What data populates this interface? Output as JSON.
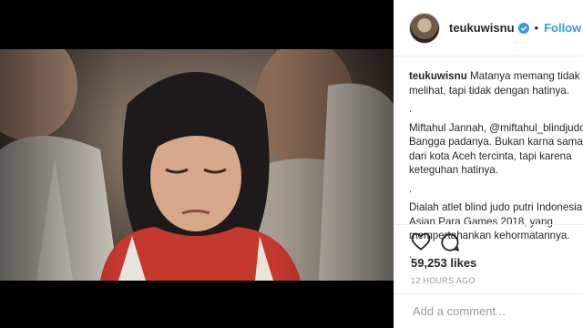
{
  "post": {
    "username": "teukuwisnu",
    "follow_label": "Follow",
    "separator": "•",
    "caption": {
      "username": "teukuwisnu",
      "lines": [
        "Matanya memang tidak",
        "melihat, tapi tidak dengan hatinya.",
        ".",
        "Miftahul Jannah, @miftahul_blindjudo",
        "Bangga padanya. Bukan karna sama-s",
        "dari kota Aceh tercinta, tapi karena",
        "keteguhan hatinya.",
        ".",
        "Dialah atlet blind judo putri Indonesia",
        "Asian Para Games 2018, yang",
        "mempertahankan kehormatannya.",
        "."
      ]
    },
    "likes": "59,253 likes",
    "time": "12 HOURS AGO",
    "comment_placeholder": "Add a comment..."
  },
  "icons": {
    "verified": "verified-badge-icon",
    "like": "heart-icon",
    "comment": "comment-bubble-icon"
  },
  "colors": {
    "accent": "#3897f0",
    "text": "#262626",
    "muted": "#999999",
    "border": "#efefef"
  }
}
